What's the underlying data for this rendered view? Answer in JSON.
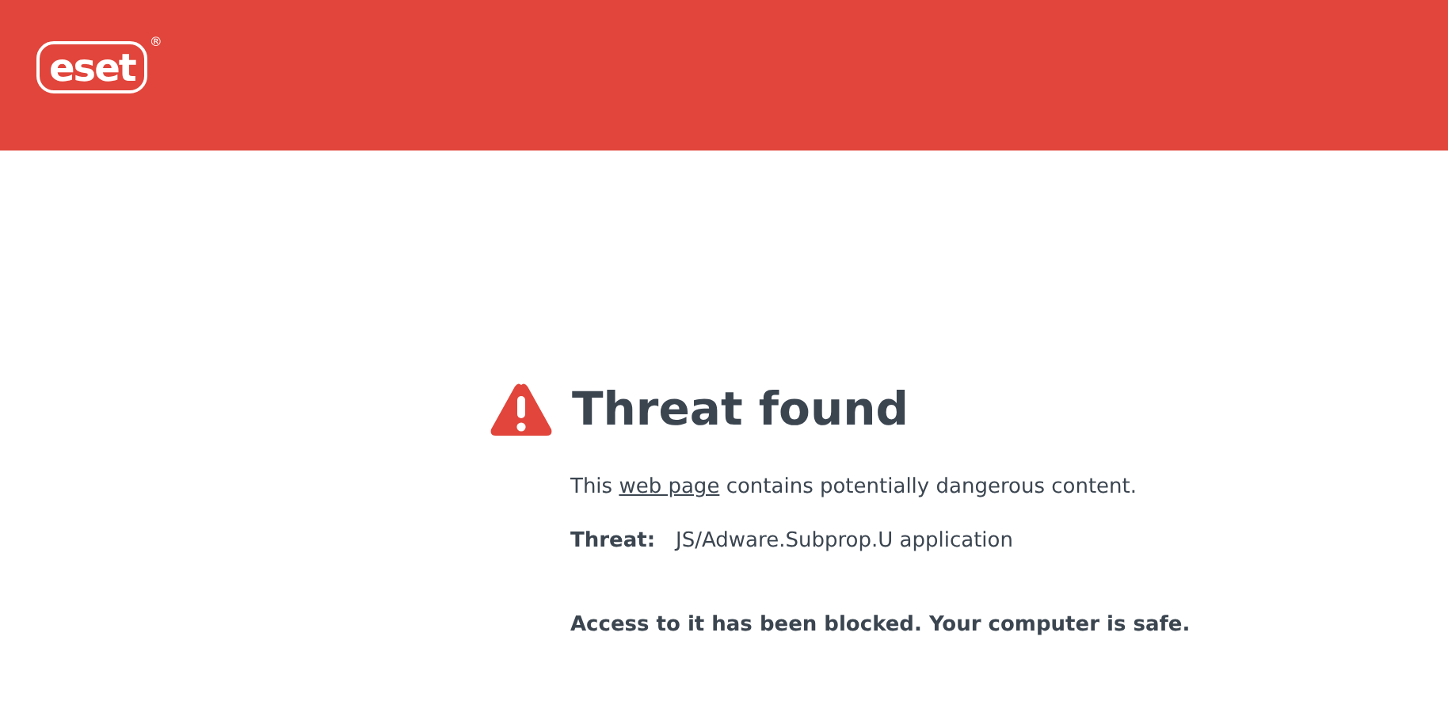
{
  "header": {
    "logo": {
      "text": "eset",
      "registered_mark": "®"
    }
  },
  "alert": {
    "title": "Threat found",
    "message": {
      "before": "This ",
      "link": "web page",
      "after": " contains potentially dangerous content."
    },
    "threat": {
      "label": "Threat:",
      "value": "JS/Adware.Subprop.U application"
    },
    "conclusion": "Access to it has been blocked. Your computer is safe."
  }
}
